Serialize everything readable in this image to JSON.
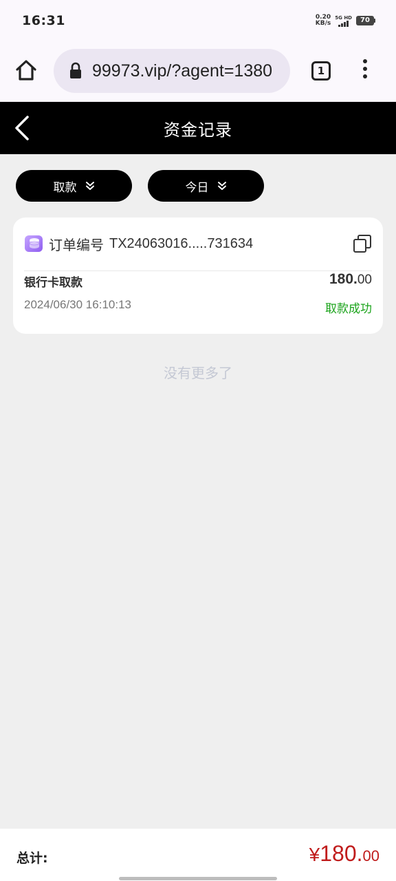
{
  "status_bar": {
    "time": "16:31",
    "net_speed_value": "0.20",
    "net_speed_unit": "KB/s",
    "network_label": "5G HD",
    "battery": "70"
  },
  "browser": {
    "url": "99973.vip/?agent=1380",
    "tab_count": "1",
    "icons": [
      "home-icon",
      "lock-icon",
      "tabs-icon",
      "more-vert-icon"
    ]
  },
  "header": {
    "title": "资金记录",
    "back_icon": "chevron-left-icon"
  },
  "filters": [
    {
      "label": "取款",
      "icon": "double-chevron-down-icon"
    },
    {
      "label": "今日",
      "icon": "double-chevron-down-icon"
    }
  ],
  "records": [
    {
      "order_label": "订单编号",
      "order_no": "TX24063016.....731634",
      "type": "银行卡取款",
      "amount_int": "180.",
      "amount_dec": "00",
      "datetime": "2024/06/30 16:10:13",
      "status": "取款成功",
      "status_color": "#1aa31a"
    }
  ],
  "no_more_text": "没有更多了",
  "footer": {
    "total_label": "总计:",
    "currency": "¥",
    "total_int": "180.",
    "total_dec": "00",
    "total_color": "#c01c1c"
  }
}
